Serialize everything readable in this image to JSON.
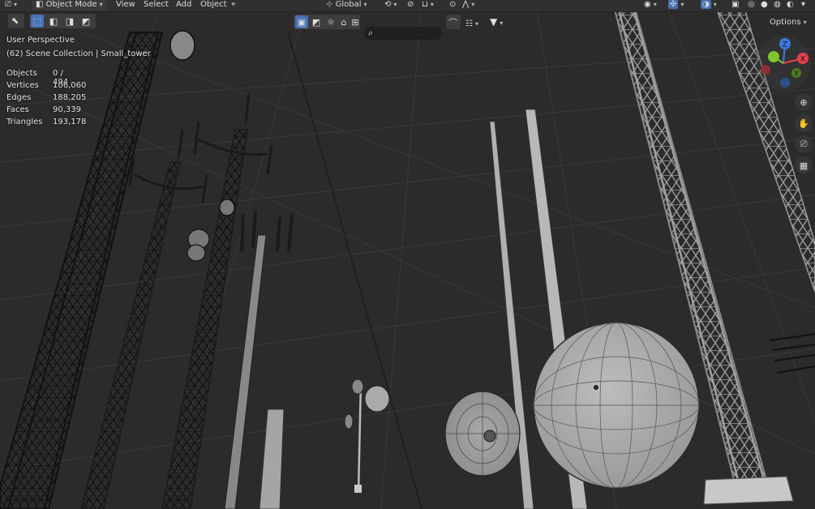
{
  "header": {
    "mode_label": "Object Mode",
    "menus": [
      "View",
      "Select",
      "Add",
      "Object"
    ],
    "transform_orientation": "Global",
    "options_label": "Options"
  },
  "overlay": {
    "view_name": "User Perspective",
    "collection": "(62) Scene Collection | Small_tower",
    "stats": [
      {
        "label": "Objects",
        "value": "0 / 494"
      },
      {
        "label": "Vertices",
        "value": "106,060"
      },
      {
        "label": "Edges",
        "value": "188,205"
      },
      {
        "label": "Faces",
        "value": "90,339"
      },
      {
        "label": "Triangles",
        "value": "193,178"
      }
    ]
  },
  "gizmo": {
    "axes": [
      "Z",
      "X",
      "Y"
    ],
    "colors": {
      "x": "#e2414d",
      "y": "#7fc62e",
      "z": "#3d7be0"
    }
  },
  "colors": {
    "background": "#2b2b2b",
    "header": "#303030",
    "accent": "#4772b3"
  }
}
